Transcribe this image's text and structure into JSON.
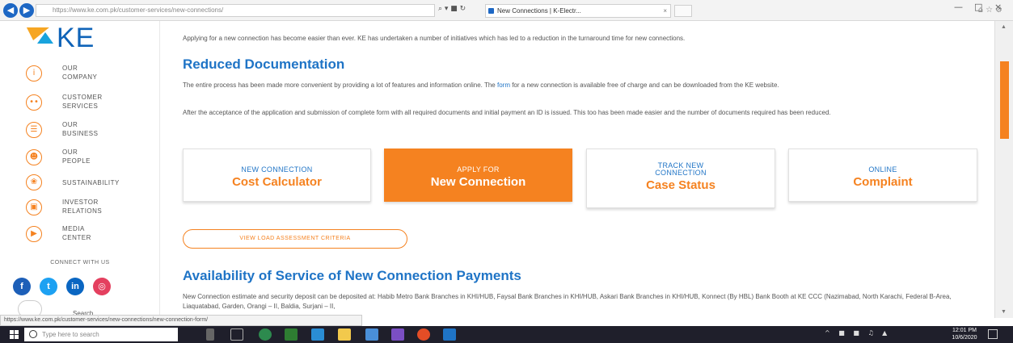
{
  "browser": {
    "address_url": "https://www.ke.com.pk/customer-services/new-connections/",
    "address_host_part": "ke.com.pk",
    "tab_title": "New Connections | K-Electr...",
    "status_url": "https://www.ke.com.pk/customer-services/new-connections/new-connection-form/"
  },
  "logo": {
    "text": "KE"
  },
  "sidebar": {
    "items": [
      {
        "label": "OUR\nCOMPANY",
        "icon": "info-icon"
      },
      {
        "label": "CUSTOMER\nSERVICES",
        "icon": "customer-icon"
      },
      {
        "label": "OUR\nBUSINESS",
        "icon": "business-icon"
      },
      {
        "label": "OUR\nPEOPLE",
        "icon": "people-icon"
      },
      {
        "label": "SUSTAINABILITY",
        "icon": "sustainability-icon"
      },
      {
        "label": "INVESTOR\nRELATIONS",
        "icon": "investor-icon"
      },
      {
        "label": "MEDIA\nCENTER",
        "icon": "media-icon"
      }
    ],
    "connect_label": "CONNECT WITH US",
    "search_label": "Search"
  },
  "main": {
    "intro": "Applying for a new connection has become easier than ever. KE has undertaken a number of initiatives which has led to a reduction in the turnaround time for new connections.",
    "heading_reduced": "Reduced Documentation",
    "para1_before": "The entire process has been made more convenient by providing a lot of features and information online. The ",
    "para1_link": "form",
    "para1_after": " for a new connection is available free of charge and can be downloaded from the KE website.",
    "para2": "After the acceptance of the application and submission of complete form with all required documents and initial payment an ID is issued. This too has been made easier and the number of documents required has been reduced.",
    "cards": [
      {
        "small": "NEW CONNECTION",
        "big": "Cost Calculator"
      },
      {
        "small": "APPLY FOR",
        "big": "New Connection"
      },
      {
        "small": "TRACK NEW\nCONNECTION",
        "big": "Case Status"
      },
      {
        "small": "ONLINE",
        "big": "Complaint"
      }
    ],
    "load_button": "VIEW LOAD ASSESSMENT CRITERIA",
    "heading_availability": "Availability of Service of New Connection Payments",
    "para3": "New Connection estimate and security deposit can be deposited at: Habib Metro Bank Branches in KHI/HUB, Faysal Bank Branches in KHI/HUB, Askari Bank Branches in KHI/HUB, Konnect (By HBL) Bank Booth at KE CCC (Nazimabad, North Karachi, Federal B-Area, Liaquatabad, Garden, Orangi – II, Baldia, Surjani – II,"
  },
  "taskbar": {
    "search_placeholder": "Type here to search",
    "time": "12:01 PM",
    "date": "10/6/2020"
  },
  "colors": {
    "brand_orange": "#f58220",
    "brand_blue": "#1f74c6"
  }
}
